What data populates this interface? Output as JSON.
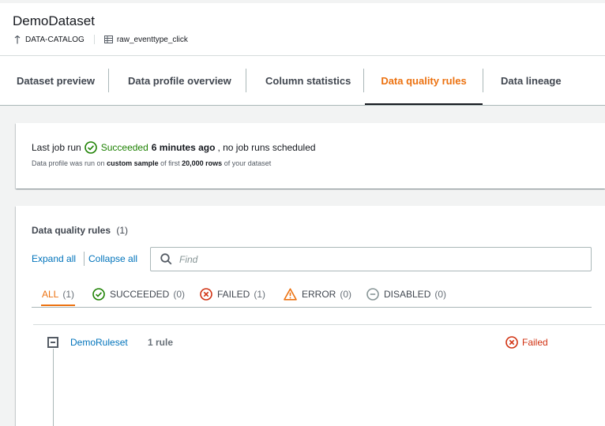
{
  "header": {
    "title": "DemoDataset",
    "catalog_label": "DATA-CATALOG",
    "table_label": "raw_eventtype_click"
  },
  "tabs": [
    {
      "label": "Dataset preview"
    },
    {
      "label": "Data profile overview"
    },
    {
      "label": "Column statistics"
    },
    {
      "label": "Data quality rules",
      "active": true
    },
    {
      "label": "Data lineage"
    }
  ],
  "job": {
    "prefix": "Last job run",
    "status": "Succeeded",
    "time": "6 minutes ago",
    "suffix": ", no job runs scheduled",
    "note_1": "Data profile was run on",
    "note_sample": "custom sample",
    "note_2": "of first",
    "note_rows": "20,000 rows",
    "note_3": "of your dataset"
  },
  "rules": {
    "title": "Data quality rules",
    "count": "(1)",
    "expand_all": "Expand all",
    "collapse_all": "Collapse all",
    "search_placeholder": "Find",
    "filters": [
      {
        "label": "ALL",
        "count": "(1)",
        "icon": "none",
        "active": true
      },
      {
        "label": "SUCCEEDED",
        "count": "(0)",
        "icon": "check-circle-icon"
      },
      {
        "label": "FAILED",
        "count": "(1)",
        "icon": "x-circle-icon"
      },
      {
        "label": "ERROR",
        "count": "(0)",
        "icon": "warning-icon"
      },
      {
        "label": "DISABLED",
        "count": "(0)",
        "icon": "minus-circle-icon"
      }
    ],
    "ruleset": {
      "name": "DemoRuleset",
      "count": "1 rule",
      "status": "Failed"
    }
  },
  "colors": {
    "accent": "#ec7211",
    "link": "#0073bb",
    "success": "#1d8102",
    "error": "#d13212"
  }
}
